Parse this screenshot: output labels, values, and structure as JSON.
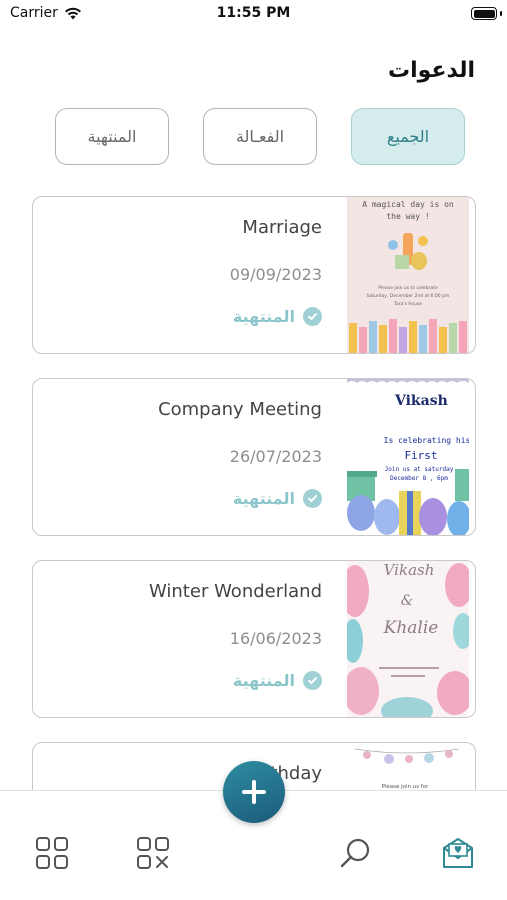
{
  "status_bar": {
    "carrier": "Carrier",
    "time": "11:55 PM"
  },
  "header": {
    "title": "الدعوات"
  },
  "tabs": [
    {
      "label": "الجميع",
      "active": true
    },
    {
      "label": "الفعـالة",
      "active": false
    },
    {
      "label": "المنتهية",
      "active": false
    }
  ],
  "invitations": [
    {
      "title": "Marriage",
      "date": "09/09/2023",
      "status": "المنتهية",
      "thumb": {
        "line1": "A magical day is on",
        "line2": "the way !",
        "line3": "Please join us to celebrate",
        "line4": "Saturday, December 2nd at 6:00 pm",
        "line5": "Tara's house"
      }
    },
    {
      "title": "Company Meeting",
      "date": "26/07/2023",
      "status": "المنتهية",
      "thumb": {
        "line1": "Vikash",
        "line2": "Is celebrating his",
        "line3": "First",
        "line4": "Join us at saturday",
        "line5": "December 8 , 6pm"
      }
    },
    {
      "title": "Winter Wonderland",
      "date": "16/06/2023",
      "status": "المنتهية",
      "thumb": {
        "line1": "Vikash",
        "line2": "&",
        "line3": "Khalie"
      }
    },
    {
      "title": "Birthday",
      "date": "",
      "status": "",
      "thumb": {
        "line1": "Please join us for"
      }
    }
  ],
  "colors": {
    "accent": "#2e7f88",
    "active_tab_bg": "#d4ecec",
    "status": "#8cc6ca",
    "fab": "#1f6a85"
  },
  "nav": [
    "grid-icon",
    "grid-x-icon",
    "search-icon",
    "invitations-icon"
  ],
  "fab": {
    "icon": "plus-icon"
  }
}
